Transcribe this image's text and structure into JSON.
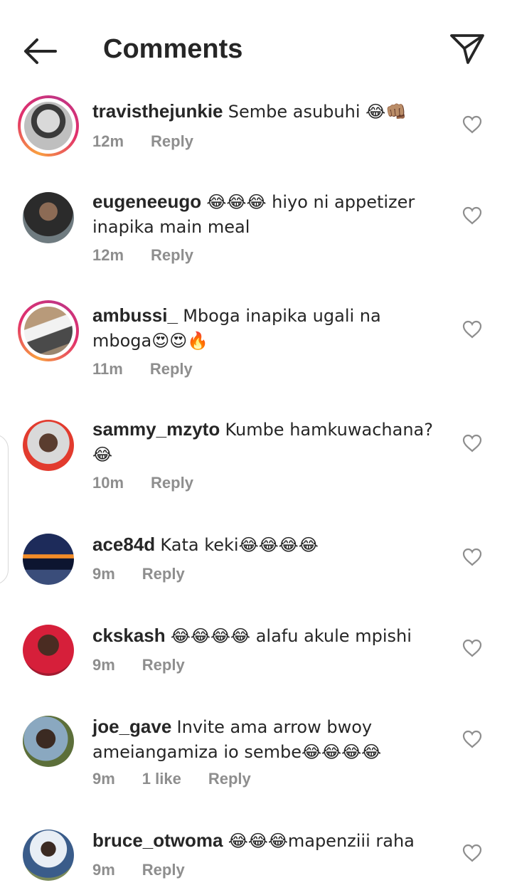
{
  "header": {
    "title": "Comments"
  },
  "comments": [
    {
      "username": "travisthejunkie",
      "text": "Sembe asubuhi 😂👊🏽",
      "time": "12m",
      "likes": "",
      "reply": "Reply"
    },
    {
      "username": "eugeneeugo",
      "text": "😂😂😂 hiyo ni appetizer inapika main meal",
      "time": "12m",
      "likes": "",
      "reply": "Reply"
    },
    {
      "username": "ambussi_",
      "text": "Mboga inapika ugali na mboga😍😍🔥",
      "time": "11m",
      "likes": "",
      "reply": "Reply"
    },
    {
      "username": "sammy_mzyto",
      "text": "Kumbe hamkuwachana? 😂",
      "time": "10m",
      "likes": "",
      "reply": "Reply"
    },
    {
      "username": "ace84d",
      "text": "Kata keki😂😂😂😂",
      "time": "9m",
      "likes": "",
      "reply": "Reply"
    },
    {
      "username": "ckskash",
      "text": "😂😂😂😂 alafu akule mpishi",
      "time": "9m",
      "likes": "",
      "reply": "Reply"
    },
    {
      "username": "joe_gave",
      "text": "Invite ama arrow bwoy ameiangamiza io sembe😂😂😂😂",
      "time": "9m",
      "likes": "1 like",
      "reply": "Reply"
    },
    {
      "username": "bruce_otwoma",
      "text": "😂😂😂mapenziii raha",
      "time": "9m",
      "likes": "",
      "reply": "Reply"
    }
  ],
  "icons": {
    "back": "arrow-left-icon",
    "send": "paper-plane-icon",
    "like": "heart-outline-icon"
  }
}
